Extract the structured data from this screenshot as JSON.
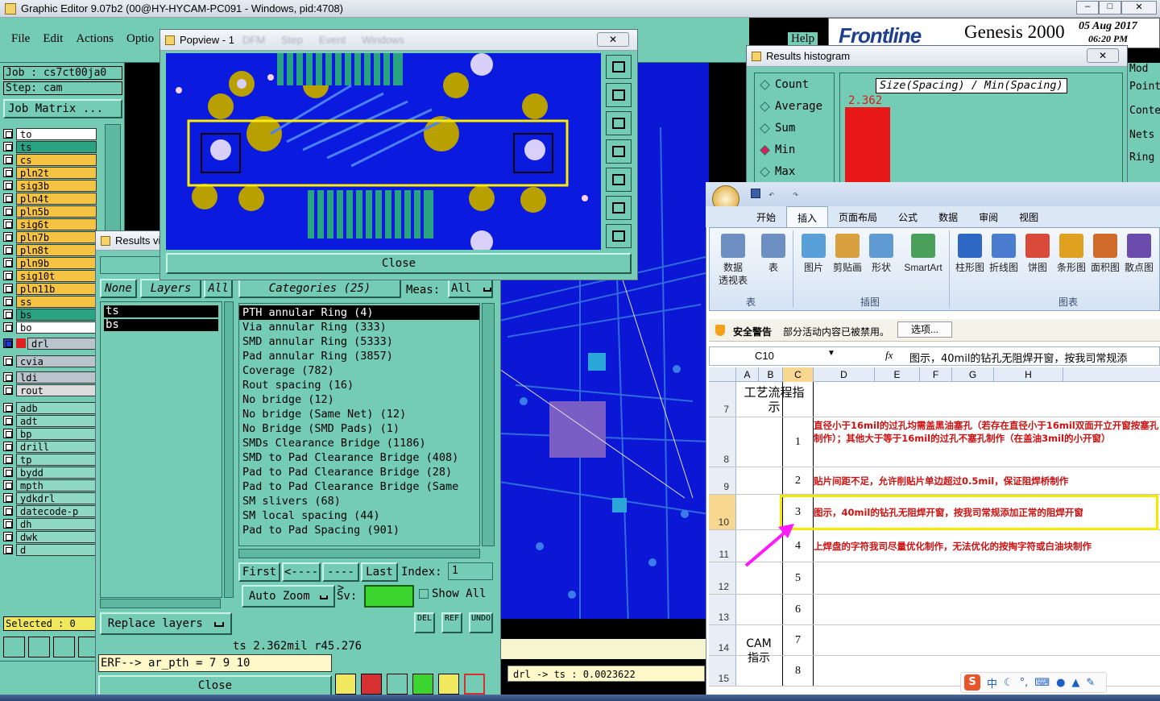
{
  "main_window": {
    "title": "Graphic Editor 9.07b2 (00@HY-HYCAM-PC091 - Windows, pid:4708)",
    "menu": [
      "File",
      "Edit",
      "Actions",
      "Optio"
    ],
    "help": "Help",
    "job": "Job : cs7ct00ja0",
    "step": "Step: cam",
    "job_matrix": "Job Matrix ...",
    "selected": "Selected : 0",
    "brand": "Frontline",
    "product": "Genesis 2000",
    "date": "05 Aug 2017",
    "time": "06:20 PM",
    "right_labels": [
      "Mod",
      "Point",
      "Conte",
      "Nets",
      "Ring"
    ],
    "status": "drl -> ts : 0.0023622"
  },
  "layers": [
    {
      "name": "to",
      "color": "#ffffff"
    },
    {
      "name": "ts",
      "color": "#2aa383"
    },
    {
      "name": "cs",
      "color": "#f5c242"
    },
    {
      "name": "pln2t",
      "color": "#f5c242"
    },
    {
      "name": "sig3b",
      "color": "#f5c242"
    },
    {
      "name": "pln4t",
      "color": "#f5c242"
    },
    {
      "name": "pln5b",
      "color": "#f5c242"
    },
    {
      "name": "sig6t",
      "color": "#f5c242"
    },
    {
      "name": "pln7b",
      "color": "#f5c242"
    },
    {
      "name": "pln8t",
      "color": "#f5c242"
    },
    {
      "name": "pln9b",
      "color": "#f5c242"
    },
    {
      "name": "sig10t",
      "color": "#f5c242"
    },
    {
      "name": "pln11b",
      "color": "#f5c242"
    },
    {
      "name": "ss",
      "color": "#f5c242"
    },
    {
      "name": "bs",
      "color": "#2aa383"
    },
    {
      "name": "bo",
      "color": "#ffffff"
    }
  ],
  "layers2": [
    {
      "name": "drl",
      "color": "#b9c4cc"
    },
    {
      "name": "cvia",
      "color": "#b9c4cc"
    },
    {
      "name": "ldi",
      "color": "#b9c4cc"
    },
    {
      "name": "rout",
      "color": "#dcdcdc"
    }
  ],
  "layers3": [
    "adb",
    "adt",
    "bp",
    "drill",
    "tp",
    "bydd",
    "mpth",
    "ydkdrl",
    "datecode-p",
    "dh",
    "dwk",
    "d"
  ],
  "popview": {
    "title": "Popview - 1",
    "menu": [
      "DFM",
      "Step",
      "Event",
      "Windows"
    ],
    "close": "Close"
  },
  "results": {
    "title": "Results vi",
    "none": "None",
    "layers": "Layers",
    "all": "All",
    "layer_list": [
      "ts",
      "bs"
    ],
    "categories_header": "Categories (25)",
    "meas_label": "Meas:",
    "meas_value": "All",
    "categories": [
      "PTH annular Ring (4)",
      "Via annular Ring (333)",
      "SMD annular Ring (5333)",
      "Pad annular Ring (3857)",
      "Coverage (782)",
      "Rout spacing (16)",
      "No bridge (12)",
      "No bridge (Same Net) (12)",
      "No Bridge (SMD Pads) (1)",
      "SMDs Clearance Bridge (1186)",
      "SMD to Pad Clearance Bridge (408)",
      "Pad to Pad Clearance Bridge (28)",
      "Pad to Pad Clearance Bridge (Same",
      "SM slivers (68)",
      "SM local spacing (44)",
      "Pad to Pad Spacing (901)"
    ],
    "first": "First",
    "prev": "<----",
    "next": "---->",
    "last": "Last",
    "index_label": "Index:",
    "index_value": "1",
    "auto_zoom": "Auto Zoom",
    "sv": "Sv:",
    "show_all": "Show All",
    "replace_layers": "Replace layers",
    "del": "DEL",
    "ref": "REF",
    "undo": "UNDO",
    "info": "ts 2.362mil  r45.276",
    "erf": "ERF--> ar_pth = 7 9 10",
    "close": "Close"
  },
  "histogram": {
    "title": "Results histogram",
    "options": [
      "Count",
      "Average",
      "Sum",
      "Min",
      "Max"
    ],
    "selected": "Min",
    "chart_title": "Size(Spacing) / Min(Spacing)",
    "value": "2.362"
  },
  "excel": {
    "tabs": [
      "开始",
      "插入",
      "页面布局",
      "公式",
      "数据",
      "审阅",
      "视图"
    ],
    "active_tab": "插入",
    "ribbon_groups": [
      "表",
      "插图",
      "图表"
    ],
    "buttons": [
      "数据\n透视表",
      "表",
      "图片",
      "剪贴画",
      "形状",
      "SmartArt",
      "柱形图",
      "折线图",
      "饼图",
      "条形图",
      "面积图",
      "散点图"
    ],
    "security_label": "安全警告",
    "security_msg": "部分活动内容已被禁用。",
    "options_btn": "选项...",
    "name_box": "C10",
    "fx": "fx",
    "formula": "图示，40mil的钻孔无阻焊开窗，按我司常规添",
    "columns": [
      "A",
      "B",
      "C",
      "D",
      "E",
      "F",
      "G",
      "H"
    ],
    "section1": "工艺流程指示",
    "section2": "CAM指示",
    "rows": [
      {
        "rn": "7",
        "num": "",
        "text": ""
      },
      {
        "rn": "8",
        "num": "1",
        "text": "直径小于16mil的过孔均需盖黑油塞孔（若存在直径小于16mil双面开立开窗按塞孔制作）；其他大于等于16mil的过孔不塞孔制作（在盖油3mil的小开窗）"
      },
      {
        "rn": "9",
        "num": "2",
        "text": "贴片间距不足，允许削贴片单边超过0.5mil，保证阻焊桥制作"
      },
      {
        "rn": "10",
        "num": "3",
        "text": "图示，40mil的钻孔无阻焊开窗，按我司常规添加正常的阻焊开窗"
      },
      {
        "rn": "11",
        "num": "4",
        "text": "上焊盘的字符我司尽量优化制作，无法优化的按掏字符或白油块制作"
      },
      {
        "rn": "12",
        "num": "5",
        "text": ""
      },
      {
        "rn": "13",
        "num": "6",
        "text": ""
      },
      {
        "rn": "14",
        "num": "7",
        "text": ""
      },
      {
        "rn": "15",
        "num": "8",
        "text": ""
      }
    ],
    "ime": "中"
  }
}
